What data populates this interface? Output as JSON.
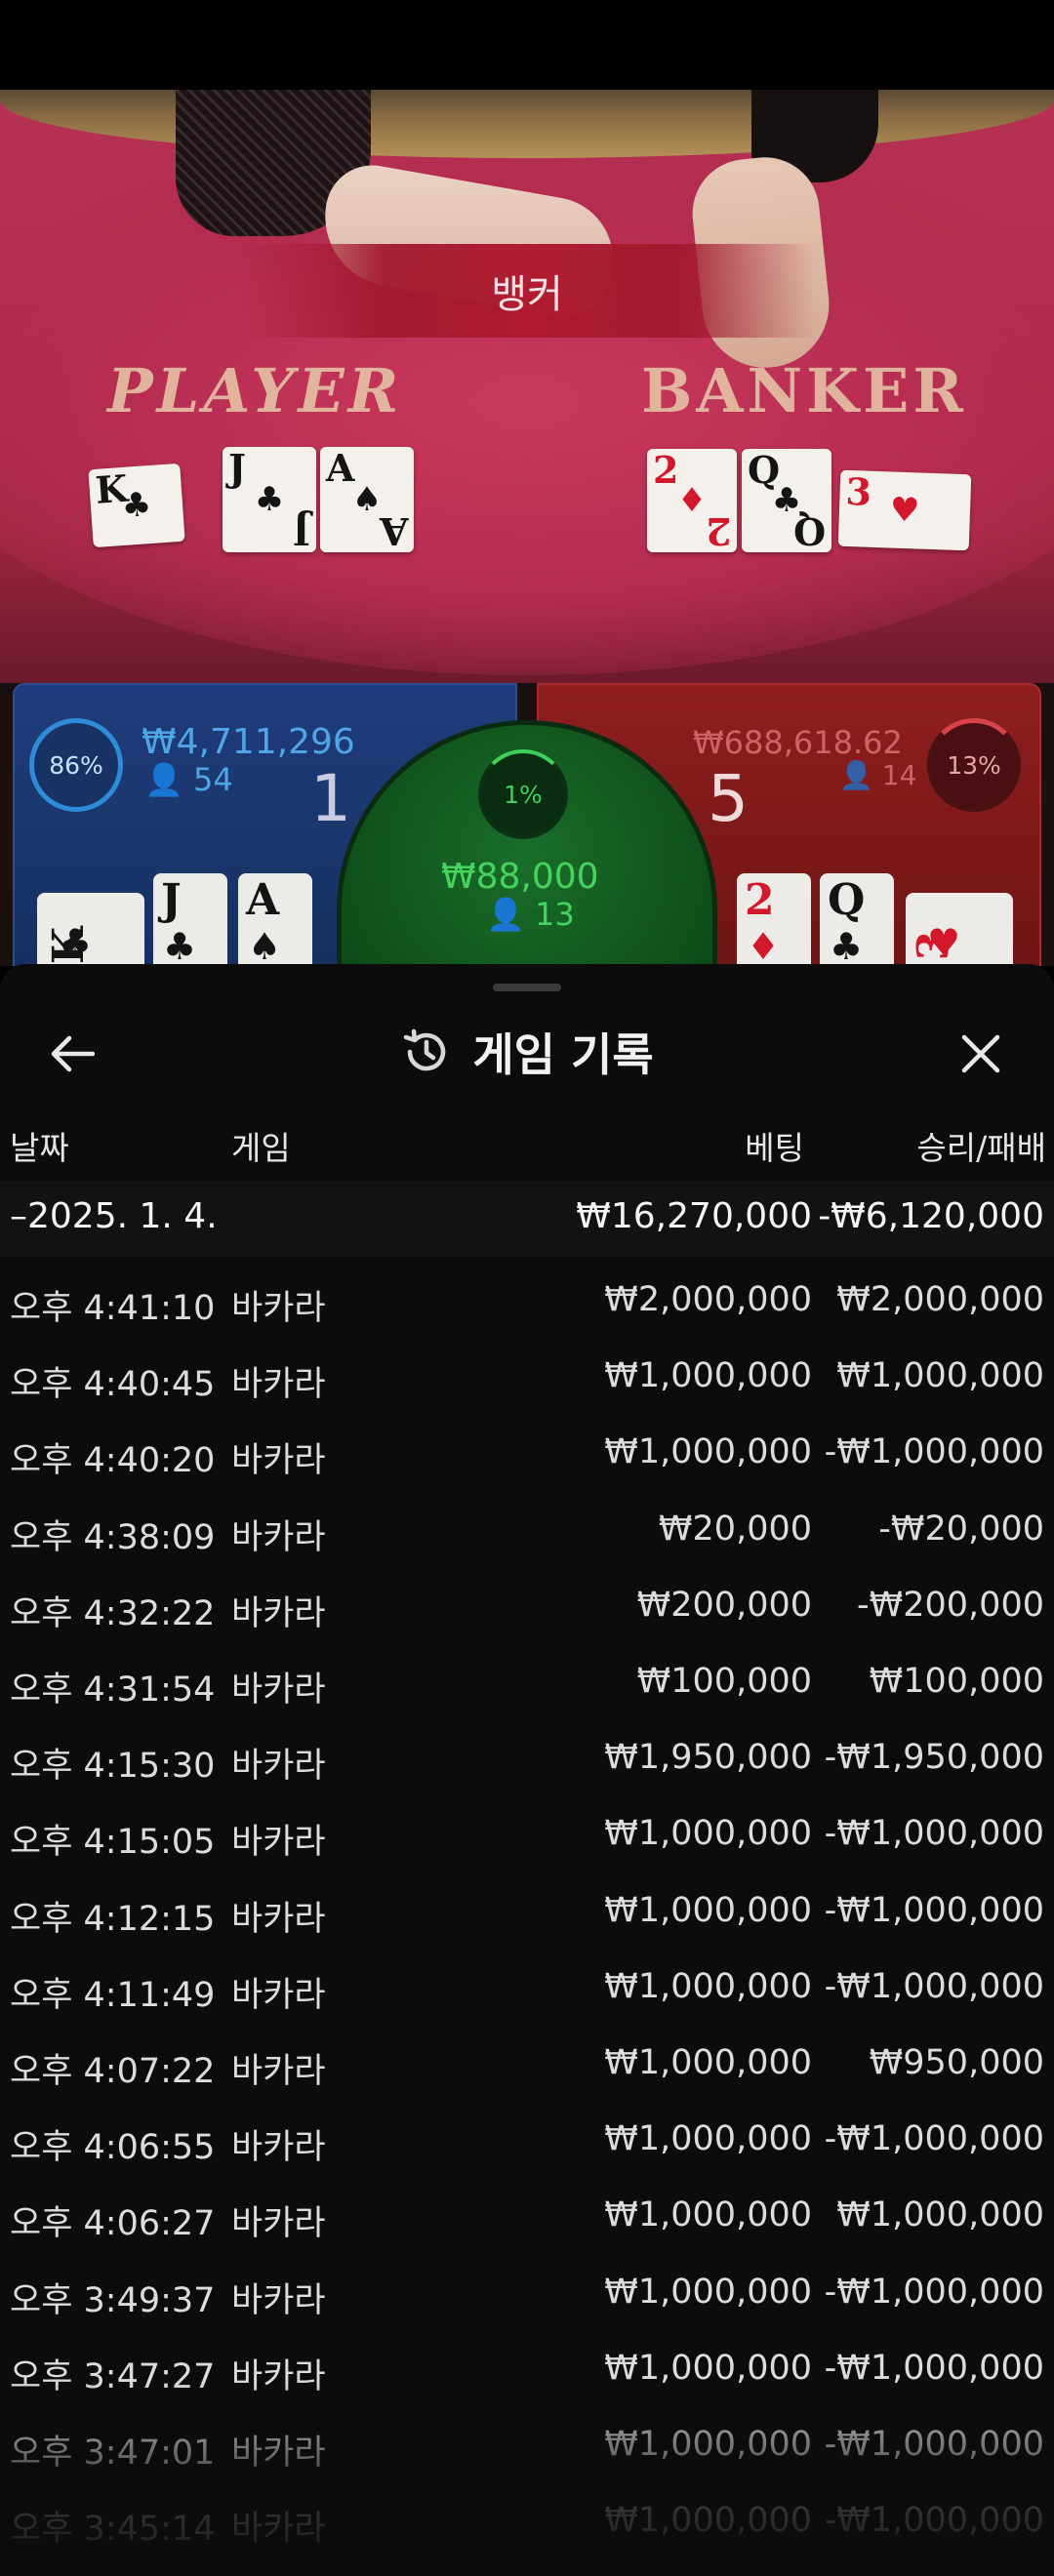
{
  "video": {
    "result_banner": "뱅커",
    "player_label": "PLAYER",
    "banker_label": "BANKER",
    "player_cards": [
      {
        "rank": "K",
        "suit": "♣",
        "color": "black"
      },
      {
        "rank": "J",
        "suit": "♣",
        "color": "black"
      },
      {
        "rank": "A",
        "suit": "♠",
        "color": "black"
      }
    ],
    "banker_cards": [
      {
        "rank": "2",
        "suit": "♦",
        "color": "red"
      },
      {
        "rank": "Q",
        "suit": "♣",
        "color": "black"
      },
      {
        "rank": "3",
        "suit": "♥",
        "color": "red"
      }
    ]
  },
  "bets": {
    "player": {
      "percent": "86%",
      "amount": "₩4,711,296",
      "count": "54",
      "score": "1"
    },
    "banker": {
      "percent": "13%",
      "amount": "₩688,618.62",
      "count": "14",
      "score": "5"
    },
    "tie": {
      "percent": "1%",
      "amount": "₩88,000",
      "count": "13"
    },
    "player_mini_cards": [
      {
        "rank": "K",
        "suit": "♣",
        "color": "black"
      },
      {
        "rank": "J",
        "suit": "♣",
        "color": "black"
      },
      {
        "rank": "A",
        "suit": "♠",
        "color": "black"
      }
    ],
    "banker_mini_cards": [
      {
        "rank": "2",
        "suit": "♦",
        "color": "red"
      },
      {
        "rank": "Q",
        "suit": "♣",
        "color": "black"
      },
      {
        "rank": "3",
        "suit": "♥",
        "color": "red"
      }
    ]
  },
  "history": {
    "title": "게임 기록",
    "icons": {
      "back": "arrow-left-icon",
      "title": "history-icon",
      "close": "close-icon"
    },
    "columns": {
      "date": "날짜",
      "game": "게임",
      "bet": "베팅",
      "result": "승리/패배"
    },
    "summary": {
      "date": "–2025. 1. 4.",
      "bet": "₩16,270,000",
      "result": "-₩6,120,000"
    },
    "rows": [
      {
        "time": "오후 4:41:10",
        "game": "바카라",
        "bet": "₩2,000,000",
        "result": "₩2,000,000"
      },
      {
        "time": "오후 4:40:45",
        "game": "바카라",
        "bet": "₩1,000,000",
        "result": "₩1,000,000"
      },
      {
        "time": "오후 4:40:20",
        "game": "바카라",
        "bet": "₩1,000,000",
        "result": "-₩1,000,000"
      },
      {
        "time": "오후 4:38:09",
        "game": "바카라",
        "bet": "₩20,000",
        "result": "-₩20,000"
      },
      {
        "time": "오후 4:32:22",
        "game": "바카라",
        "bet": "₩200,000",
        "result": "-₩200,000"
      },
      {
        "time": "오후 4:31:54",
        "game": "바카라",
        "bet": "₩100,000",
        "result": "₩100,000"
      },
      {
        "time": "오후 4:15:30",
        "game": "바카라",
        "bet": "₩1,950,000",
        "result": "-₩1,950,000"
      },
      {
        "time": "오후 4:15:05",
        "game": "바카라",
        "bet": "₩1,000,000",
        "result": "-₩1,000,000"
      },
      {
        "time": "오후 4:12:15",
        "game": "바카라",
        "bet": "₩1,000,000",
        "result": "-₩1,000,000"
      },
      {
        "time": "오후 4:11:49",
        "game": "바카라",
        "bet": "₩1,000,000",
        "result": "-₩1,000,000"
      },
      {
        "time": "오후 4:07:22",
        "game": "바카라",
        "bet": "₩1,000,000",
        "result": "₩950,000"
      },
      {
        "time": "오후 4:06:55",
        "game": "바카라",
        "bet": "₩1,000,000",
        "result": "-₩1,000,000"
      },
      {
        "time": "오후 4:06:27",
        "game": "바카라",
        "bet": "₩1,000,000",
        "result": "₩1,000,000"
      },
      {
        "time": "오후 3:49:37",
        "game": "바카라",
        "bet": "₩1,000,000",
        "result": "-₩1,000,000"
      },
      {
        "time": "오후 3:47:27",
        "game": "바카라",
        "bet": "₩1,000,000",
        "result": "-₩1,000,000"
      },
      {
        "time": "오후 3:47:01",
        "game": "바카라",
        "bet": "₩1,000,000",
        "result": "-₩1,000,000"
      },
      {
        "time": "오후 3:45:14",
        "game": "바카라",
        "bet": "₩1,000,000",
        "result": "-₩1,000,000"
      }
    ]
  }
}
